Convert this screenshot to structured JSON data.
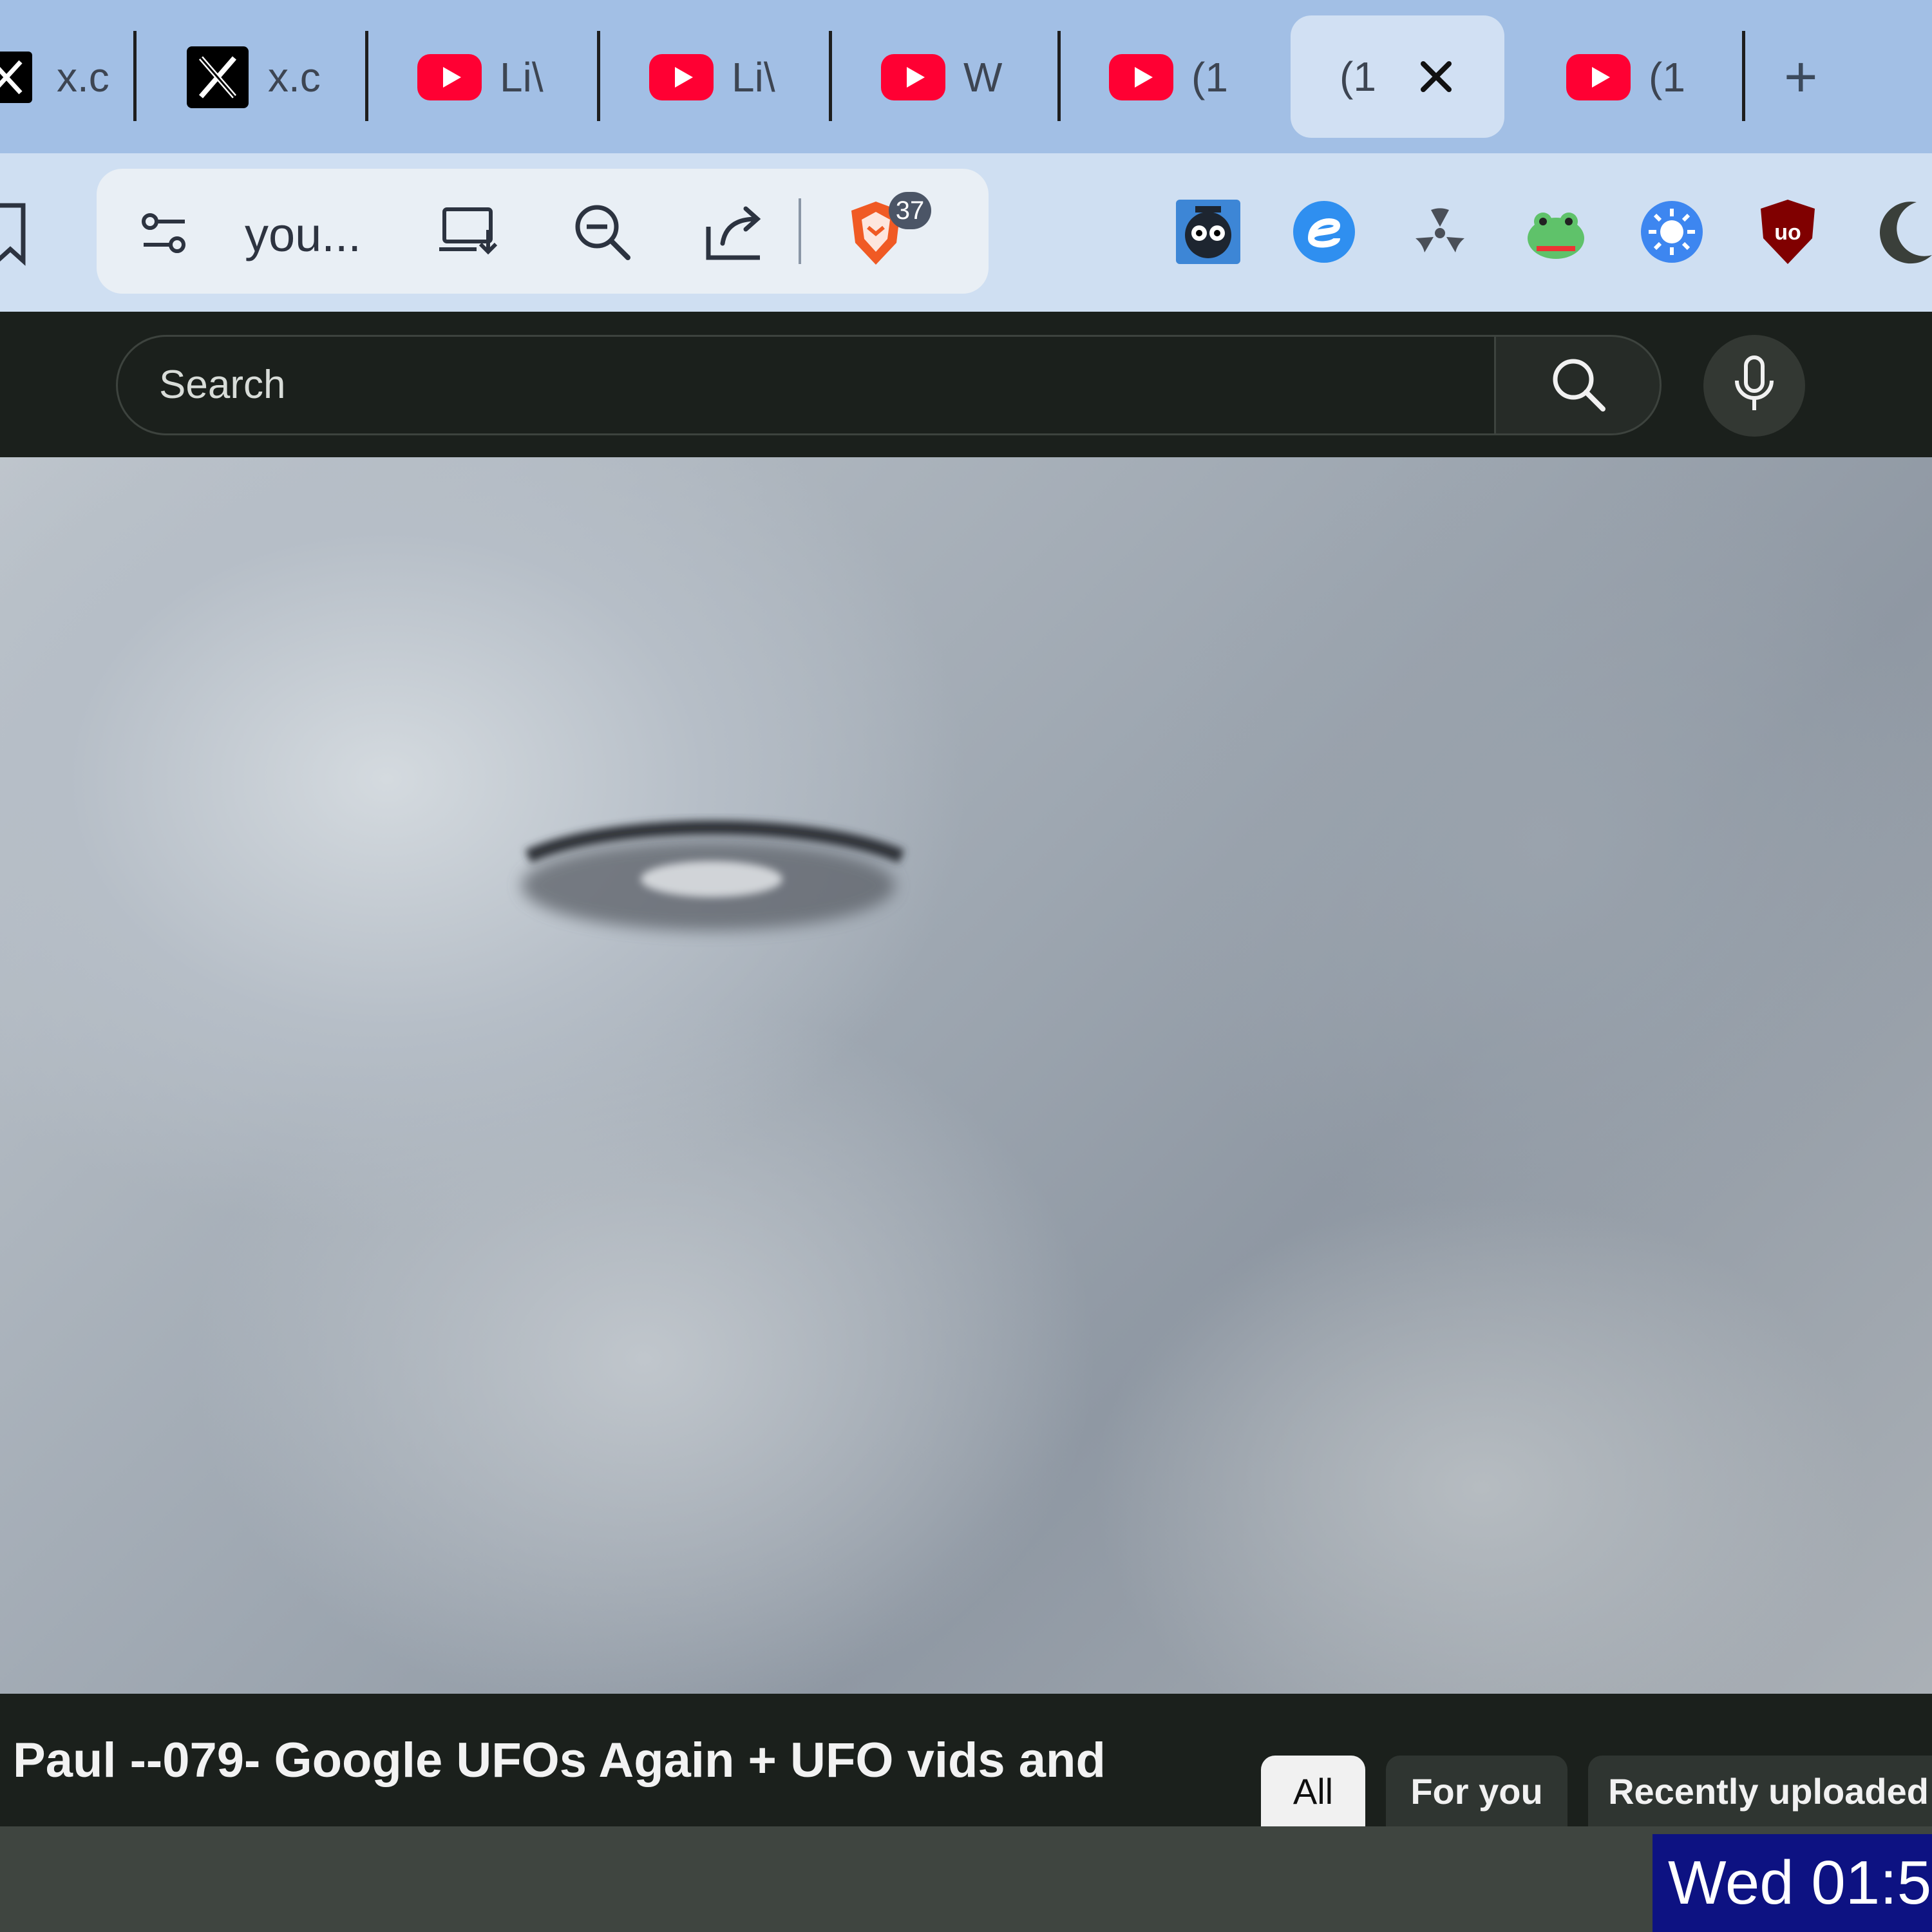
{
  "tabs": [
    {
      "title": "x.c",
      "icon": "x-logo-icon"
    },
    {
      "title": "x.c",
      "icon": "x-logo-icon"
    },
    {
      "title": "Li\\",
      "icon": "youtube-icon"
    },
    {
      "title": "Li\\",
      "icon": "youtube-icon"
    },
    {
      "title": "W",
      "icon": "youtube-icon"
    },
    {
      "title": "(1",
      "icon": "youtube-icon"
    },
    {
      "title": "(1",
      "icon": "close-icon",
      "active": true
    },
    {
      "title": "(1",
      "icon": "youtube-icon"
    }
  ],
  "new_tab_label": "+",
  "omnibox": {
    "text": "you...",
    "shields_count": "37"
  },
  "search": {
    "placeholder": "Search"
  },
  "video": {
    "title": "Paul --079- Google UFOs Again + UFO vids and"
  },
  "chips": [
    {
      "label": "All",
      "selected": true
    },
    {
      "label": "For you"
    },
    {
      "label": "Recently uploaded"
    }
  ],
  "taskbar": {
    "clock": "Wed 01:5"
  },
  "colors": {
    "youtube_red": "#ff0033",
    "tabstrip": "#a2bfe5",
    "youtube_bg": "#1b201c",
    "clock_bg": "#0d1282"
  }
}
